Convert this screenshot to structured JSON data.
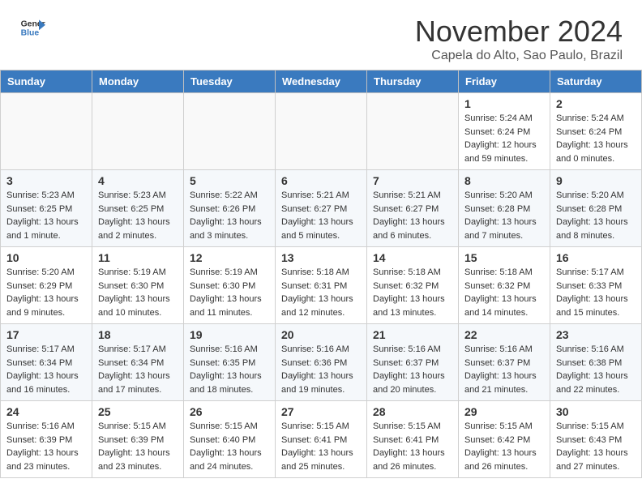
{
  "header": {
    "logo_line1": "General",
    "logo_line2": "Blue",
    "month_title": "November 2024",
    "location": "Capela do Alto, Sao Paulo, Brazil"
  },
  "weekdays": [
    "Sunday",
    "Monday",
    "Tuesday",
    "Wednesday",
    "Thursday",
    "Friday",
    "Saturday"
  ],
  "weeks": [
    [
      {
        "day": "",
        "info": ""
      },
      {
        "day": "",
        "info": ""
      },
      {
        "day": "",
        "info": ""
      },
      {
        "day": "",
        "info": ""
      },
      {
        "day": "",
        "info": ""
      },
      {
        "day": "1",
        "info": "Sunrise: 5:24 AM\nSunset: 6:24 PM\nDaylight: 12 hours\nand 59 minutes."
      },
      {
        "day": "2",
        "info": "Sunrise: 5:24 AM\nSunset: 6:24 PM\nDaylight: 13 hours\nand 0 minutes."
      }
    ],
    [
      {
        "day": "3",
        "info": "Sunrise: 5:23 AM\nSunset: 6:25 PM\nDaylight: 13 hours\nand 1 minute."
      },
      {
        "day": "4",
        "info": "Sunrise: 5:23 AM\nSunset: 6:25 PM\nDaylight: 13 hours\nand 2 minutes."
      },
      {
        "day": "5",
        "info": "Sunrise: 5:22 AM\nSunset: 6:26 PM\nDaylight: 13 hours\nand 3 minutes."
      },
      {
        "day": "6",
        "info": "Sunrise: 5:21 AM\nSunset: 6:27 PM\nDaylight: 13 hours\nand 5 minutes."
      },
      {
        "day": "7",
        "info": "Sunrise: 5:21 AM\nSunset: 6:27 PM\nDaylight: 13 hours\nand 6 minutes."
      },
      {
        "day": "8",
        "info": "Sunrise: 5:20 AM\nSunset: 6:28 PM\nDaylight: 13 hours\nand 7 minutes."
      },
      {
        "day": "9",
        "info": "Sunrise: 5:20 AM\nSunset: 6:28 PM\nDaylight: 13 hours\nand 8 minutes."
      }
    ],
    [
      {
        "day": "10",
        "info": "Sunrise: 5:20 AM\nSunset: 6:29 PM\nDaylight: 13 hours\nand 9 minutes."
      },
      {
        "day": "11",
        "info": "Sunrise: 5:19 AM\nSunset: 6:30 PM\nDaylight: 13 hours\nand 10 minutes."
      },
      {
        "day": "12",
        "info": "Sunrise: 5:19 AM\nSunset: 6:30 PM\nDaylight: 13 hours\nand 11 minutes."
      },
      {
        "day": "13",
        "info": "Sunrise: 5:18 AM\nSunset: 6:31 PM\nDaylight: 13 hours\nand 12 minutes."
      },
      {
        "day": "14",
        "info": "Sunrise: 5:18 AM\nSunset: 6:32 PM\nDaylight: 13 hours\nand 13 minutes."
      },
      {
        "day": "15",
        "info": "Sunrise: 5:18 AM\nSunset: 6:32 PM\nDaylight: 13 hours\nand 14 minutes."
      },
      {
        "day": "16",
        "info": "Sunrise: 5:17 AM\nSunset: 6:33 PM\nDaylight: 13 hours\nand 15 minutes."
      }
    ],
    [
      {
        "day": "17",
        "info": "Sunrise: 5:17 AM\nSunset: 6:34 PM\nDaylight: 13 hours\nand 16 minutes."
      },
      {
        "day": "18",
        "info": "Sunrise: 5:17 AM\nSunset: 6:34 PM\nDaylight: 13 hours\nand 17 minutes."
      },
      {
        "day": "19",
        "info": "Sunrise: 5:16 AM\nSunset: 6:35 PM\nDaylight: 13 hours\nand 18 minutes."
      },
      {
        "day": "20",
        "info": "Sunrise: 5:16 AM\nSunset: 6:36 PM\nDaylight: 13 hours\nand 19 minutes."
      },
      {
        "day": "21",
        "info": "Sunrise: 5:16 AM\nSunset: 6:37 PM\nDaylight: 13 hours\nand 20 minutes."
      },
      {
        "day": "22",
        "info": "Sunrise: 5:16 AM\nSunset: 6:37 PM\nDaylight: 13 hours\nand 21 minutes."
      },
      {
        "day": "23",
        "info": "Sunrise: 5:16 AM\nSunset: 6:38 PM\nDaylight: 13 hours\nand 22 minutes."
      }
    ],
    [
      {
        "day": "24",
        "info": "Sunrise: 5:16 AM\nSunset: 6:39 PM\nDaylight: 13 hours\nand 23 minutes."
      },
      {
        "day": "25",
        "info": "Sunrise: 5:15 AM\nSunset: 6:39 PM\nDaylight: 13 hours\nand 23 minutes."
      },
      {
        "day": "26",
        "info": "Sunrise: 5:15 AM\nSunset: 6:40 PM\nDaylight: 13 hours\nand 24 minutes."
      },
      {
        "day": "27",
        "info": "Sunrise: 5:15 AM\nSunset: 6:41 PM\nDaylight: 13 hours\nand 25 minutes."
      },
      {
        "day": "28",
        "info": "Sunrise: 5:15 AM\nSunset: 6:41 PM\nDaylight: 13 hours\nand 26 minutes."
      },
      {
        "day": "29",
        "info": "Sunrise: 5:15 AM\nSunset: 6:42 PM\nDaylight: 13 hours\nand 26 minutes."
      },
      {
        "day": "30",
        "info": "Sunrise: 5:15 AM\nSunset: 6:43 PM\nDaylight: 13 hours\nand 27 minutes."
      }
    ]
  ]
}
